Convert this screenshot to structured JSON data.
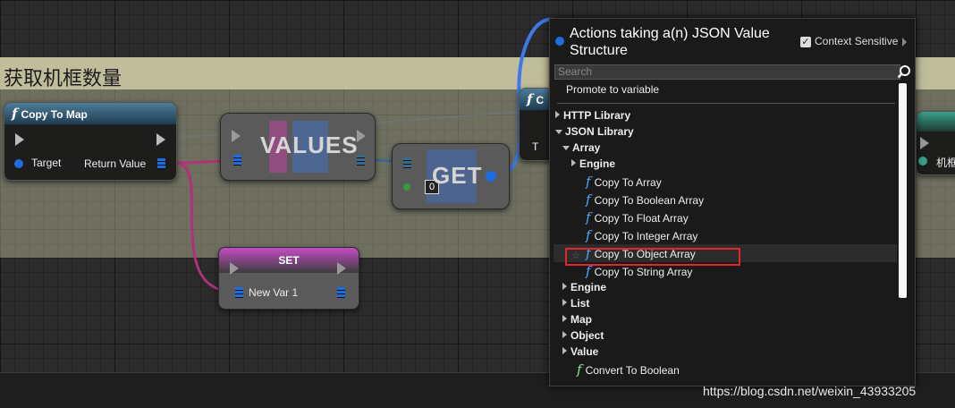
{
  "graph": {
    "comment_title": "获取机框数量",
    "nodes": {
      "copy_to_map": {
        "title": "Copy To Map",
        "target_label": "Target",
        "return_label": "Return Value"
      },
      "values": {
        "title": "VALUES"
      },
      "get": {
        "title": "GET",
        "index": "0"
      },
      "set": {
        "title": "SET",
        "var_label": "New Var 1"
      },
      "right_partial_label": "机框",
      "behind_partial_label": "C",
      "behind_partial_pin": "T"
    }
  },
  "menu": {
    "title": "Actions taking a(n) JSON Value Structure",
    "context_sensitive_label": "Context Sensitive",
    "context_sensitive_checked": true,
    "search_placeholder": "Search",
    "promote_label": "Promote to variable",
    "items": [
      {
        "label": "HTTP Library",
        "kind": "category",
        "expanded": false,
        "depth": 0
      },
      {
        "label": "JSON Library",
        "kind": "category",
        "expanded": true,
        "depth": 0
      },
      {
        "label": "Array",
        "kind": "category",
        "expanded": true,
        "depth": 1
      },
      {
        "label": "Engine",
        "kind": "category",
        "expanded": false,
        "depth": 2
      },
      {
        "label": "Copy To Array",
        "kind": "function",
        "depth": 3
      },
      {
        "label": "Copy To Boolean Array",
        "kind": "function",
        "depth": 3
      },
      {
        "label": "Copy To Float Array",
        "kind": "function",
        "depth": 3
      },
      {
        "label": "Copy To Integer Array",
        "kind": "function",
        "depth": 3
      },
      {
        "label": "Copy To Object Array",
        "kind": "function",
        "depth": 3,
        "highlighted": true
      },
      {
        "label": "Copy To String Array",
        "kind": "function",
        "depth": 3
      },
      {
        "label": "Engine",
        "kind": "category",
        "expanded": false,
        "depth": 1
      },
      {
        "label": "List",
        "kind": "category",
        "expanded": false,
        "depth": 1
      },
      {
        "label": "Map",
        "kind": "category",
        "expanded": false,
        "depth": 1
      },
      {
        "label": "Object",
        "kind": "category",
        "expanded": false,
        "depth": 1
      },
      {
        "label": "Value",
        "kind": "category",
        "expanded": false,
        "depth": 1
      },
      {
        "label": "Convert To Boolean",
        "kind": "function",
        "depth": 2
      }
    ]
  },
  "watermark": "https://blog.csdn.net/weixin_43933205",
  "colors": {
    "pin_blue": "#1e6de0",
    "set_header": "#c44cc4",
    "highlight_box": "#e0282a",
    "function_icon": "#4aa7ff"
  }
}
